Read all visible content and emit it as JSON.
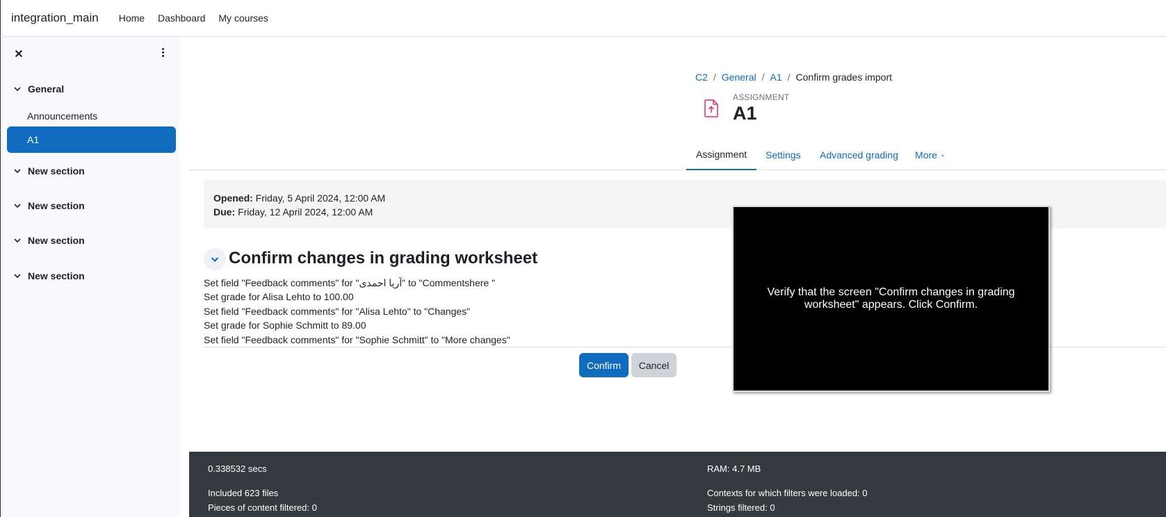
{
  "navbar": {
    "brand": "integration_main",
    "links": [
      "Home",
      "Dashboard",
      "My courses"
    ]
  },
  "drawer": {
    "close_glyph": "✕",
    "sections": [
      {
        "label": "General",
        "items": [
          "Announcements",
          "A1"
        ],
        "active_item": "A1"
      },
      {
        "label": "New section"
      },
      {
        "label": "New section"
      },
      {
        "label": "New section"
      },
      {
        "label": "New section"
      }
    ]
  },
  "breadcrumb": {
    "items": [
      "C2",
      "General",
      "A1"
    ],
    "current": "Confirm grades import"
  },
  "module": {
    "kicker": "ASSIGNMENT",
    "title": "A1",
    "icon": "assignment-upload-icon",
    "icon_color": "#e8286e"
  },
  "tabs": {
    "items": [
      "Assignment",
      "Settings",
      "Advanced grading",
      "More"
    ],
    "active": "Assignment",
    "more_caret": "⌄"
  },
  "dates": {
    "opened_label": "Opened:",
    "opened_value": "Friday, 5 April 2024, 12:00 AM",
    "due_label": "Due:",
    "due_value": "Friday, 12 April 2024, 12:00 AM"
  },
  "section_heading": "Confirm changes in grading worksheet",
  "changes": [
    "Set field \"Feedback comments\" for \"آریا احمدی\" to \"Commentshere \"",
    "Set grade for Alisa Lehto to 100.00",
    "Set field \"Feedback comments\" for \"Alisa Lehto\" to \"Changes\"",
    "Set grade for Sophie Schmitt to 89.00",
    "Set field \"Feedback comments\" for \"Sophie Schmitt\" to \"More changes\""
  ],
  "buttons": {
    "confirm": "Confirm",
    "cancel": "Cancel"
  },
  "overlay": {
    "text": "Verify that the screen \"Confirm changes in grading worksheet\" appears. Click Confirm."
  },
  "footer": {
    "time": "0.338532 secs",
    "ram": "RAM: 4.7 MB",
    "files": "Included 623 files",
    "contexts": "Contexts for which filters were loaded: 0",
    "pieces": "Pieces of content filtered: 0",
    "strings": "Strings filtered: 0"
  },
  "colors": {
    "primary": "#0f6cbf",
    "footer_bg": "#343a40",
    "drawer_bg": "#f8f9fa"
  }
}
